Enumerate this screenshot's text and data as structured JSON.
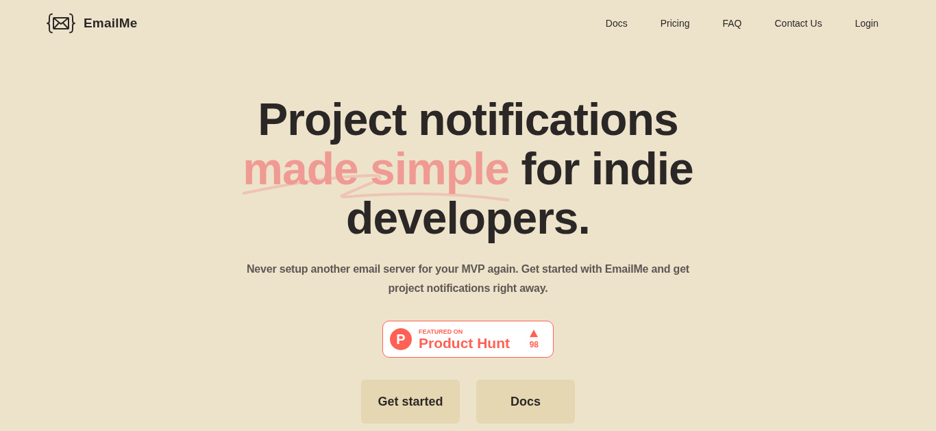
{
  "header": {
    "brand": "EmailMe",
    "nav": [
      {
        "label": "Docs"
      },
      {
        "label": "Pricing"
      },
      {
        "label": "FAQ"
      },
      {
        "label": "Contact Us"
      },
      {
        "label": "Login"
      }
    ]
  },
  "hero": {
    "headline": {
      "before": "Project notifications",
      "highlight": "made simple",
      "after": "for indie developers."
    },
    "subtitle": "Never setup another email server for your MVP again. Get started with EmailMe and get project notifications right away.",
    "badge": {
      "logo_letter": "P",
      "kicker": "FEATURED ON",
      "name": "Product Hunt",
      "votes": "98"
    },
    "buttons": [
      {
        "label": "Get started"
      },
      {
        "label": "Docs"
      }
    ]
  }
}
